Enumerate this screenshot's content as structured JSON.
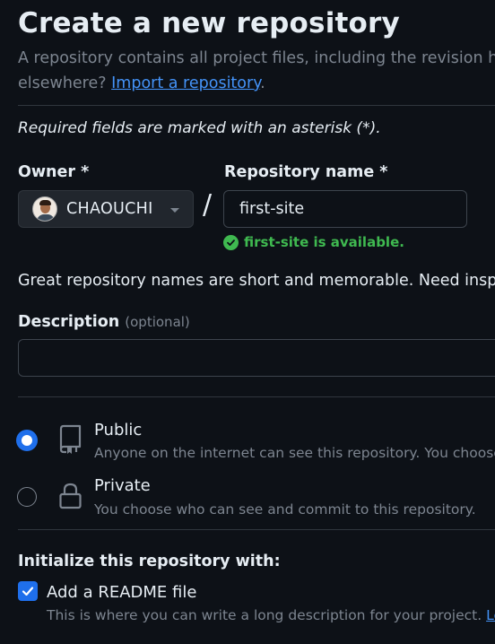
{
  "header": {
    "title": "Create a new repository",
    "subtitle_line1": "A repository contains all project files, including the revision h",
    "subtitle_line2_prefix": "elsewhere? ",
    "import_link": "Import a repository",
    "subtitle_line2_suffix": "."
  },
  "required_note": "Required fields are marked with an asterisk (*).",
  "owner": {
    "label": "Owner *",
    "value": "CHAOUCHI"
  },
  "separator": "/",
  "repo_name": {
    "label": "Repository name *",
    "value": "first-site",
    "availability": "first-site is available."
  },
  "name_tip": "Great repository names are short and memorable. Need insp",
  "description": {
    "label": "Description",
    "optional": "(optional)",
    "value": ""
  },
  "visibility": {
    "public": {
      "title": "Public",
      "desc": "Anyone on the internet can see this repository. You choose w",
      "selected": true
    },
    "private": {
      "title": "Private",
      "desc": "You choose who can see and commit to this repository.",
      "selected": false
    }
  },
  "initialize": {
    "title": "Initialize this repository with:",
    "readme_label": "Add a README file",
    "readme_checked": true,
    "readme_desc": "This is where you can write a long description for your project. ",
    "readme_link": "Lear"
  },
  "colors": {
    "background": "#0d1117",
    "accent": "#1f6feb",
    "link": "#4493f8",
    "success": "#3fb950",
    "muted": "#7d8590"
  }
}
